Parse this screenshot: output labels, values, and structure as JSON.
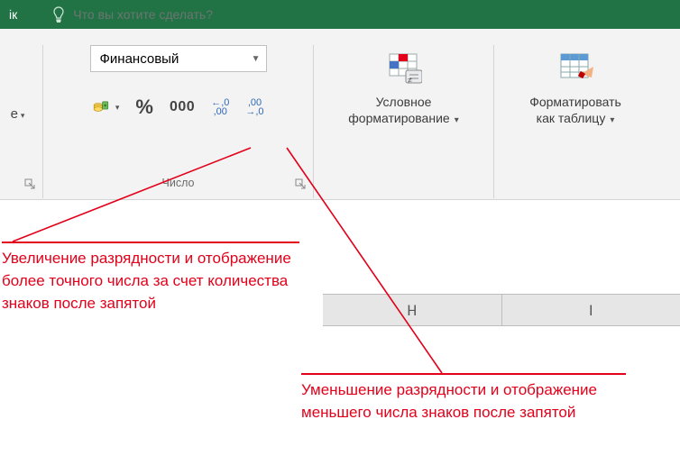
{
  "title": {
    "fragment": "ік"
  },
  "tellme": {
    "placeholder": "Что вы хотите сделать?"
  },
  "partialGroup": {
    "trail": "е",
    "dd": "▾"
  },
  "numberGroup": {
    "format": "Финансовый",
    "dd": "▾",
    "percent": "%",
    "thousands": "000",
    "increase_top": "←,0",
    "increase_bot": ",00",
    "decrease_top": ",00",
    "decrease_bot": "→,0",
    "label": "Число"
  },
  "condFmt": {
    "line1": "Условное",
    "line2": "форматирование",
    "dd": "▾"
  },
  "fmtTable": {
    "line1": "Форматировать",
    "line2": "как таблицу",
    "dd": "▾"
  },
  "columns": [
    "H",
    "I"
  ],
  "annotation1": "Увеличение разрядности и отображение более точного числа за счет количества знаков после запятой",
  "annotation2": "Уменьшение разрядности и отображение меньшего числа знаков после запятой"
}
